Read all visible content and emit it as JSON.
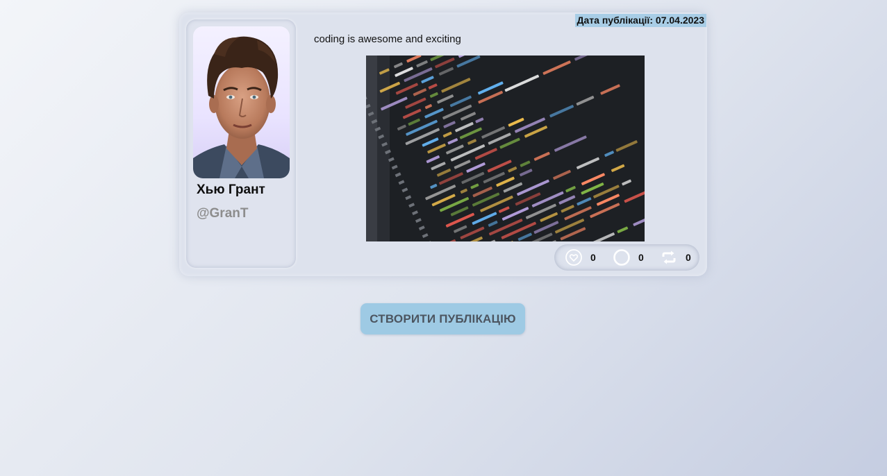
{
  "post": {
    "date_label": "Дата публікації: 07.04.2023",
    "text": "coding is awesome and exciting",
    "image_alt": "code-screen-photo",
    "author": {
      "name": "Хью Грант",
      "handle": "@GranT"
    },
    "stats": {
      "likes": "0",
      "comments": "0",
      "reposts": "0"
    }
  },
  "create_button": {
    "label": "СТВОРИТИ ПУБЛІКАЦІЮ"
  },
  "colors": {
    "date_highlight": "#a8cde6",
    "button_bg": "#9ecae4",
    "handle_text": "#8d8d8d"
  },
  "icons": {
    "like": "heart-icon",
    "comment": "comment-icon",
    "repost": "repost-icon"
  }
}
